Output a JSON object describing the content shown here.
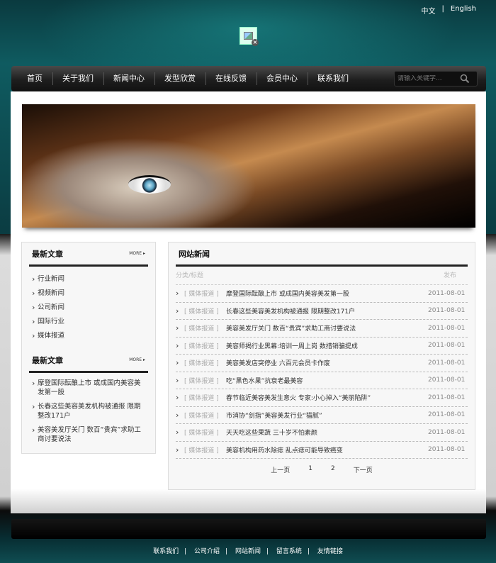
{
  "lang": {
    "cn": "中文",
    "sep": "|",
    "en": "English"
  },
  "nav": {
    "items": [
      "首页",
      "关于我们",
      "新闻中心",
      "发型欣赏",
      "在线反馈",
      "会员中心",
      "联系我们"
    ],
    "search_placeholder": "请输入关键字..."
  },
  "left": {
    "box1": {
      "title": "最新文章",
      "more": "MORE ▸",
      "items": [
        "行业新闻",
        "视频新闻",
        "公司新闻",
        "国际行业",
        "媒体报道"
      ]
    },
    "box2": {
      "title": "最新文章",
      "more": "MORE ▸",
      "items": [
        "摩登国际酝酿上市 或成国内美容美发第一股",
        "长春这些美容美发机构被通报 限期整改171户",
        "美容美发厅关门 数百“贵宾”求助工商讨要说法"
      ]
    }
  },
  "news": {
    "title": "网站新闻",
    "col_title": "分类/标题",
    "col_date": "发布",
    "rows": [
      {
        "cat": "[ 媒体报道 ]",
        "title": "摩登国际酝酿上市 或成国内美容美发第一股",
        "date": "2011-08-01"
      },
      {
        "cat": "[ 媒体报道 ]",
        "title": "长春这些美容美发机构被通报 限期整改171户",
        "date": "2011-08-01"
      },
      {
        "cat": "[ 媒体报道 ]",
        "title": "美容美发厅关门 数百“贵宾”求助工商讨要说法",
        "date": "2011-08-01"
      },
      {
        "cat": "[ 媒体报道 ]",
        "title": "美容师揭行业黑幕:培训一周上岗 数措销骗提成",
        "date": "2011-08-01"
      },
      {
        "cat": "[ 媒体报道 ]",
        "title": "美容美发店突停业 六百元会员卡作废",
        "date": "2011-08-01"
      },
      {
        "cat": "[ 媒体报道 ]",
        "title": "吃“黑色水果”抗衰老最美容",
        "date": "2011-08-01"
      },
      {
        "cat": "[ 媒体报道 ]",
        "title": "春节临近美容美发生意火 专家:小心掉入“美丽陷阱”",
        "date": "2011-08-01"
      },
      {
        "cat": "[ 媒体报道 ]",
        "title": "市消协“剑指”美容美发行业“猫腻”",
        "date": "2011-08-01"
      },
      {
        "cat": "[ 媒体报道 ]",
        "title": "天天吃这些果蔬 三十岁不怕素颜",
        "date": "2011-08-01"
      },
      {
        "cat": "[ 媒体报道 ]",
        "title": "美容机构用药水除痣 乱点痣可能导致癌变",
        "date": "2011-08-01"
      }
    ],
    "pager": {
      "prev": "上一页",
      "p1": "1",
      "p2": "2",
      "next": "下一页"
    }
  },
  "footer": {
    "links": [
      "联系我们",
      "公司介绍",
      "网站新闻",
      "留言系统",
      "友情链接"
    ],
    "sep": "|"
  }
}
